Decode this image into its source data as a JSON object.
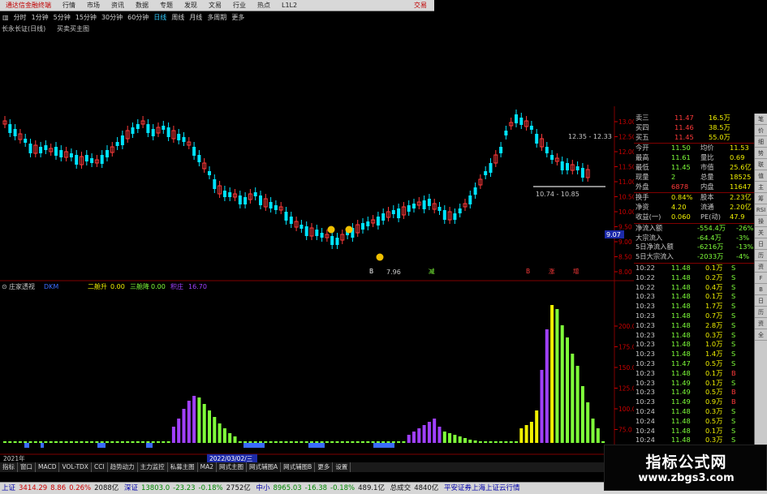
{
  "top_menu": [
    "通达信金融终端",
    "行情",
    "市场",
    "资讯",
    "数据",
    "专题",
    "发现",
    "文易",
    "行业",
    "热点",
    "L1L2",
    "交易"
  ],
  "period_tabs": [
    "分时",
    "1分钟",
    "5分钟",
    "15分钟",
    "30分钟",
    "60分钟",
    "日线",
    "周线",
    "月线",
    "多周期",
    "更多"
  ],
  "active_period": "日线",
  "stock_title": "长永长证(日线)",
  "formula_name": "买卖买主图",
  "price_axis": [
    "13.00",
    "12.50",
    "12.00",
    "11.50",
    "11.00",
    "10.50",
    "10.00",
    "9.50",
    "9.00",
    "8.50",
    "8.00"
  ],
  "price_labels": {
    "high": "12.35 - 12.33",
    "range": "10.74 - 10.85",
    "low": "7.96",
    "current": "9.07"
  },
  "kline_markers": [
    "B",
    "减",
    "B",
    "涨",
    "增"
  ],
  "indicator": {
    "name": "庄家透视",
    "v1_label": "DKM",
    "v1": "",
    "v2_label": "二舱升",
    "v2": "0.00",
    "v3_label": "三舱降",
    "v3": "0.00",
    "v4_label": "积庄",
    "v4": "16.70"
  },
  "indicator_axis": [
    "200.0",
    "175.0",
    "150.0",
    "125.0",
    "100.0",
    "75.0",
    "50.0",
    "25.0"
  ],
  "date_labels": {
    "year": "2021年",
    "cursor": "2022/03/02/三"
  },
  "quote_rows": [
    {
      "l": "卖三",
      "v": "11.47",
      "v2": "16.5万"
    },
    {
      "l": "买四",
      "v": "11.46",
      "v2": "38.5万"
    },
    {
      "l": "买五",
      "v": "11.45",
      "v2": "55.0万"
    }
  ],
  "stats": [
    {
      "l1": "今开",
      "v1": "11.50",
      "l2": "均价",
      "v2": "11.53"
    },
    {
      "l1": "最高",
      "v1": "11.61",
      "l2": "量比",
      "v2": "0.69"
    },
    {
      "l1": "最低",
      "v1": "11.45",
      "l2": "市值",
      "v2": "25.6亿"
    },
    {
      "l1": "现量",
      "v1": "2",
      "l2": "总量",
      "v2": "18525"
    },
    {
      "l1": "外盘",
      "v1": "6878",
      "l2": "内盘",
      "v2": "11647"
    }
  ],
  "stats2": [
    {
      "l1": "换手",
      "v1": "0.84%",
      "l2": "股本",
      "v2": "2.23亿"
    },
    {
      "l1": "净资",
      "v1": "4.20",
      "l2": "流通",
      "v2": "2.20亿"
    },
    {
      "l1": "收益(一)",
      "v1": "0.060",
      "l2": "PE(动)",
      "v2": "47.9"
    }
  ],
  "flow": [
    {
      "l": "净流入额",
      "v": "-554.4万",
      "p": "-26%"
    },
    {
      "l": "大宗流入",
      "v": "-64.4万",
      "p": "-3%"
    },
    {
      "l": "5日净流入额",
      "v": "-6216万",
      "p": "-13%"
    },
    {
      "l": "5日大宗流入",
      "v": "-2033万",
      "p": "-4%"
    }
  ],
  "ticks": [
    [
      "10:22",
      "11.48",
      "0.1万",
      "S"
    ],
    [
      "10:22",
      "11.48",
      "0.2万",
      "S"
    ],
    [
      "10:22",
      "11.48",
      "0.4万",
      "S"
    ],
    [
      "10:23",
      "11.48",
      "0.1万",
      "S"
    ],
    [
      "10:23",
      "11.48",
      "1.7万",
      "S"
    ],
    [
      "10:23",
      "11.48",
      "0.7万",
      "S"
    ],
    [
      "10:23",
      "11.48",
      "2.8万",
      "S"
    ],
    [
      "10:23",
      "11.48",
      "0.3万",
      "S"
    ],
    [
      "10:23",
      "11.48",
      "1.0万",
      "S"
    ],
    [
      "10:23",
      "11.48",
      "1.4万",
      "S"
    ],
    [
      "10:23",
      "11.47",
      "0.5万",
      "S"
    ],
    [
      "10:23",
      "11.48",
      "0.1万",
      "B"
    ],
    [
      "10:23",
      "11.49",
      "0.1万",
      "S"
    ],
    [
      "10:23",
      "11.49",
      "0.5万",
      "B"
    ],
    [
      "10:23",
      "11.49",
      "0.9万",
      "B"
    ],
    [
      "10:24",
      "11.48",
      "0.3万",
      "S"
    ],
    [
      "10:24",
      "11.48",
      "0.5万",
      "S"
    ],
    [
      "10:24",
      "11.48",
      "0.1万",
      "S"
    ],
    [
      "10:24",
      "11.48",
      "0.3万",
      "S"
    ]
  ],
  "right_tabs": [
    "笔",
    "价",
    "细",
    "势",
    "联",
    "值",
    "主",
    "筹",
    "RSI",
    "操",
    "关",
    "日",
    "历",
    "资",
    "F",
    "B",
    "日",
    "历",
    "资",
    "全"
  ],
  "bottom_tabs": [
    "指标",
    "窗口",
    "MACD",
    "VOL-TDX",
    "CCI",
    "趋势动力",
    "主力监控",
    "私募主图",
    "MA2",
    "网式主图",
    "网式辅图A",
    "网式辅图B",
    "更多",
    "设置"
  ],
  "bottom_right": "模板",
  "status": {
    "sh_label": "上证",
    "sh": "3414.29",
    "sh_chg": "8.86",
    "sh_pct": "0.26%",
    "sh_vol": "2088亿",
    "sz_label": "深证",
    "sz": "13803.0",
    "sz_chg": "-23.23",
    "sz_pct": "-0.18%",
    "sz_vol": "2752亿",
    "zx_label": "中小",
    "zx": "8965.03",
    "zx_chg": "-16.38",
    "zx_pct": "-0.18%",
    "zx_vol": "489.1亿",
    "total_label": "总成交",
    "total": "4840亿",
    "broker": "平安证券上海上证云行情"
  },
  "watermark": {
    "line1": "指标公式网",
    "line2": "www.zbgs3.com"
  },
  "colors": {
    "up": "#ff3a3a",
    "down": "#00e4ff",
    "yellow": "#f0f000",
    "green": "#7fff3a",
    "purple": "#a040ff",
    "grid_red": "#800000"
  }
}
